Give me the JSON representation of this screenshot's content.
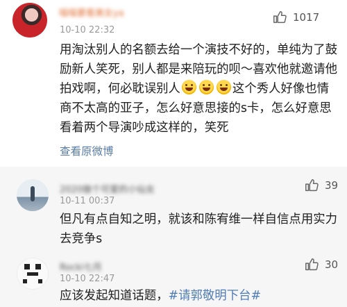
{
  "main_comment": {
    "username": "喵喵要看美女ya",
    "time": "10-10 22:32",
    "likes": "1017",
    "content_parts": [
      "用淘汰别人的名额去给一个演技不好的，单纯为了鼓励新人笑死，别人都是来陪玩的呗～喜欢他就邀请他拍戏啊，何必耽误别人",
      "这个秀人好像也情商不太高的亚子，怎么好意思接的s卡，怎么好意思看着两个导演吵成这样的，笑死"
    ],
    "emoji": [
      "grin-emoji",
      "grin-emoji",
      "grin-emoji"
    ],
    "view_original": "查看原微博"
  },
  "replies": [
    {
      "username": "2020做个可爱的小仙女",
      "time": "10-11 00:37",
      "likes": "39",
      "content": "但凡有点自知之明，就该和陈宥维一样自信点用实力去竞争s"
    },
    {
      "username": "Rocki七月",
      "time": "10-10 22:47",
      "likes": "30",
      "content_prefix": "应该发起知道话题，",
      "hashtag": "#请郭敬明下台#"
    }
  ],
  "icons": {
    "like": "thumbs-up-icon"
  }
}
